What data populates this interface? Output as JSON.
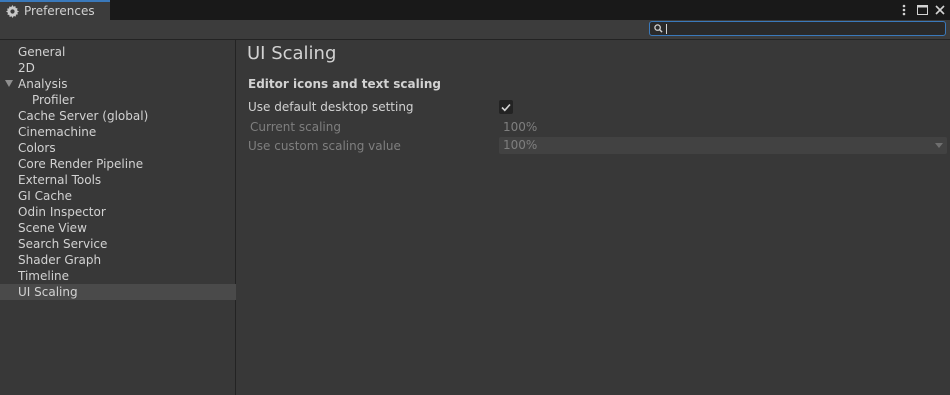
{
  "window": {
    "tab_title": "Preferences",
    "tab_icon": "gear-icon",
    "controls": [
      "more-menu-icon",
      "maximize-icon",
      "close-icon"
    ]
  },
  "search": {
    "value": "",
    "placeholder": ""
  },
  "sidebar": {
    "items": [
      {
        "label": "General"
      },
      {
        "label": "2D"
      },
      {
        "label": "Analysis"
      },
      {
        "label": "Profiler"
      },
      {
        "label": "Cache Server (global)"
      },
      {
        "label": "Cinemachine"
      },
      {
        "label": "Colors"
      },
      {
        "label": "Core Render Pipeline"
      },
      {
        "label": "External Tools"
      },
      {
        "label": "GI Cache"
      },
      {
        "label": "Odin Inspector"
      },
      {
        "label": "Scene View"
      },
      {
        "label": "Search Service"
      },
      {
        "label": "Shader Graph"
      },
      {
        "label": "Timeline"
      },
      {
        "label": "UI Scaling"
      }
    ],
    "selected": "UI Scaling"
  },
  "main": {
    "title": "UI Scaling",
    "section": "Editor icons and text scaling",
    "default_label": "Use default desktop setting",
    "default_checked": true,
    "current_label": "Current scaling",
    "current_value": "100%",
    "custom_label": "Use custom scaling value",
    "custom_value": "100%"
  },
  "colors": {
    "accent": "#3a79bb",
    "background": "#383838",
    "selected_row": "#4a4a4a",
    "text": "#d2d2d2",
    "disabled_text": "#7f7f7f"
  }
}
